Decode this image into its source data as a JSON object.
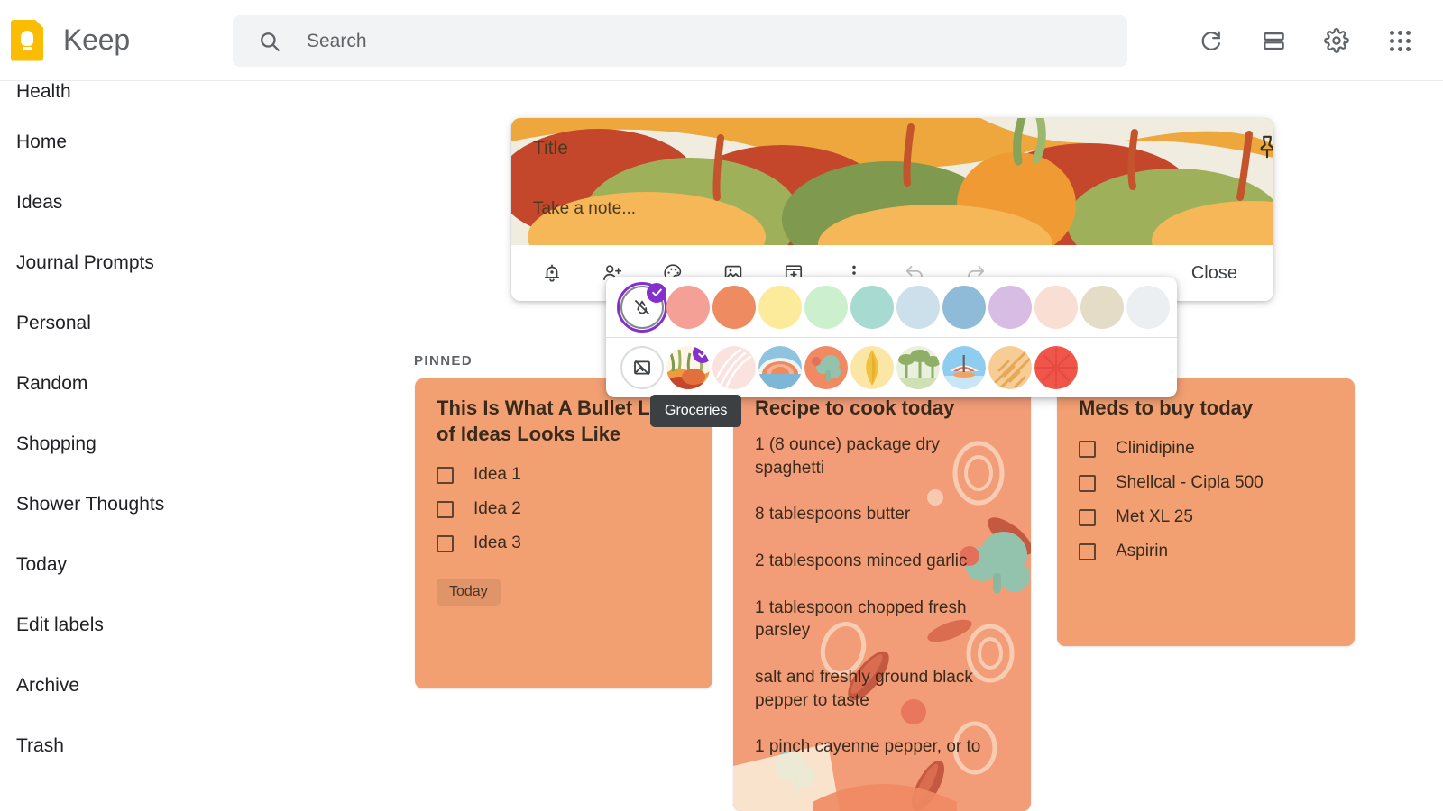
{
  "app": {
    "name": "Keep",
    "logo_color": "#fbbc04"
  },
  "search": {
    "placeholder": "Search",
    "value": "",
    "icon": "search-icon"
  },
  "header_actions": [
    {
      "name": "refresh-icon",
      "label": "Refresh"
    },
    {
      "name": "list-view-icon",
      "label": "List view"
    },
    {
      "name": "settings-gear-icon",
      "label": "Settings"
    },
    {
      "name": "apps-grid-icon",
      "label": "Google apps"
    }
  ],
  "sidebar": {
    "items": [
      {
        "label": "Health"
      },
      {
        "label": "Home"
      },
      {
        "label": "Ideas"
      },
      {
        "label": "Journal Prompts"
      },
      {
        "label": "Personal"
      },
      {
        "label": "Random"
      },
      {
        "label": "Shopping"
      },
      {
        "label": "Shower Thoughts"
      },
      {
        "label": "Today"
      },
      {
        "label": "Edit labels"
      },
      {
        "label": "Archive"
      },
      {
        "label": "Trash"
      }
    ]
  },
  "composer": {
    "title_placeholder": "Title",
    "note_placeholder": "Take a note...",
    "pin_icon": "pin-icon",
    "background_name": "Groceries",
    "close_label": "Close",
    "toolbar": [
      {
        "name": "reminder-bell-icon",
        "label": "Remind me",
        "disabled": false
      },
      {
        "name": "collaborator-add-icon",
        "label": "Collaborator",
        "disabled": false
      },
      {
        "name": "color-palette-icon",
        "label": "Background options",
        "disabled": false
      },
      {
        "name": "image-icon",
        "label": "Add image",
        "disabled": false
      },
      {
        "name": "archive-icon",
        "label": "Archive",
        "disabled": false
      },
      {
        "name": "more-vert-icon",
        "label": "More",
        "disabled": false
      },
      {
        "name": "undo-icon",
        "label": "Undo",
        "disabled": true
      },
      {
        "name": "redo-icon",
        "label": "Redo",
        "disabled": true
      }
    ]
  },
  "color_picker": {
    "tooltip": "Groceries",
    "colors": [
      {
        "name": "no-color",
        "hex": "#ffffff",
        "selected": true
      },
      {
        "name": "coral",
        "hex": "#f5a097",
        "selected": false
      },
      {
        "name": "orange",
        "hex": "#ee8b60",
        "selected": false
      },
      {
        "name": "yellow",
        "hex": "#fbeb9b",
        "selected": false
      },
      {
        "name": "green",
        "hex": "#ccf0cd",
        "selected": false
      },
      {
        "name": "teal",
        "hex": "#a7dbd2",
        "selected": false
      },
      {
        "name": "lightblue",
        "hex": "#cbe0ea",
        "selected": false
      },
      {
        "name": "blue",
        "hex": "#8fbbd9",
        "selected": false
      },
      {
        "name": "purple",
        "hex": "#d7bce4",
        "selected": false
      },
      {
        "name": "pink",
        "hex": "#f8ded3",
        "selected": false
      },
      {
        "name": "brown",
        "hex": "#e4dcc6",
        "selected": false
      },
      {
        "name": "gray",
        "hex": "#eceff1",
        "selected": false
      }
    ],
    "backgrounds": [
      {
        "name": "no-background",
        "label": "No background",
        "selected": false
      },
      {
        "name": "groceries",
        "label": "Groceries",
        "selected": true
      },
      {
        "name": "food",
        "label": "Food",
        "selected": false
      },
      {
        "name": "music",
        "label": "Music",
        "selected": false
      },
      {
        "name": "recipes",
        "label": "Recipes",
        "selected": false
      },
      {
        "name": "notes",
        "label": "Notes",
        "selected": false
      },
      {
        "name": "places",
        "label": "Places",
        "selected": false
      },
      {
        "name": "travel",
        "label": "Travel",
        "selected": false
      },
      {
        "name": "video",
        "label": "Video",
        "selected": false
      },
      {
        "name": "celebration",
        "label": "Celebration",
        "selected": false
      }
    ]
  },
  "notes_section": {
    "pinned_label": "PINNED",
    "card_bg": "#f2a072"
  },
  "notes": [
    {
      "id": "ideas-note",
      "title": "This Is What A Bullet List of Ideas Looks Like",
      "items": [
        {
          "label": "Idea 1",
          "checked": false
        },
        {
          "label": "Idea 2",
          "checked": false
        },
        {
          "label": "Idea 3",
          "checked": false
        }
      ],
      "label_chip": "Today"
    },
    {
      "id": "recipe-note",
      "title": "Recipe to cook today",
      "lines": [
        "1 (8 ounce) package dry spaghetti",
        "8 tablespoons butter",
        "2 tablespoons minced garlic",
        "1 tablespoon chopped fresh parsley",
        "salt and freshly ground black pepper to taste",
        "1 pinch cayenne pepper, or to"
      ]
    },
    {
      "id": "meds-note",
      "title": "Meds to buy today",
      "items": [
        {
          "label": "Clinidipine",
          "checked": false
        },
        {
          "label": "Shellcal - Cipla 500",
          "checked": false
        },
        {
          "label": "Met XL 25",
          "checked": false
        },
        {
          "label": "Aspirin",
          "checked": false
        }
      ]
    }
  ]
}
